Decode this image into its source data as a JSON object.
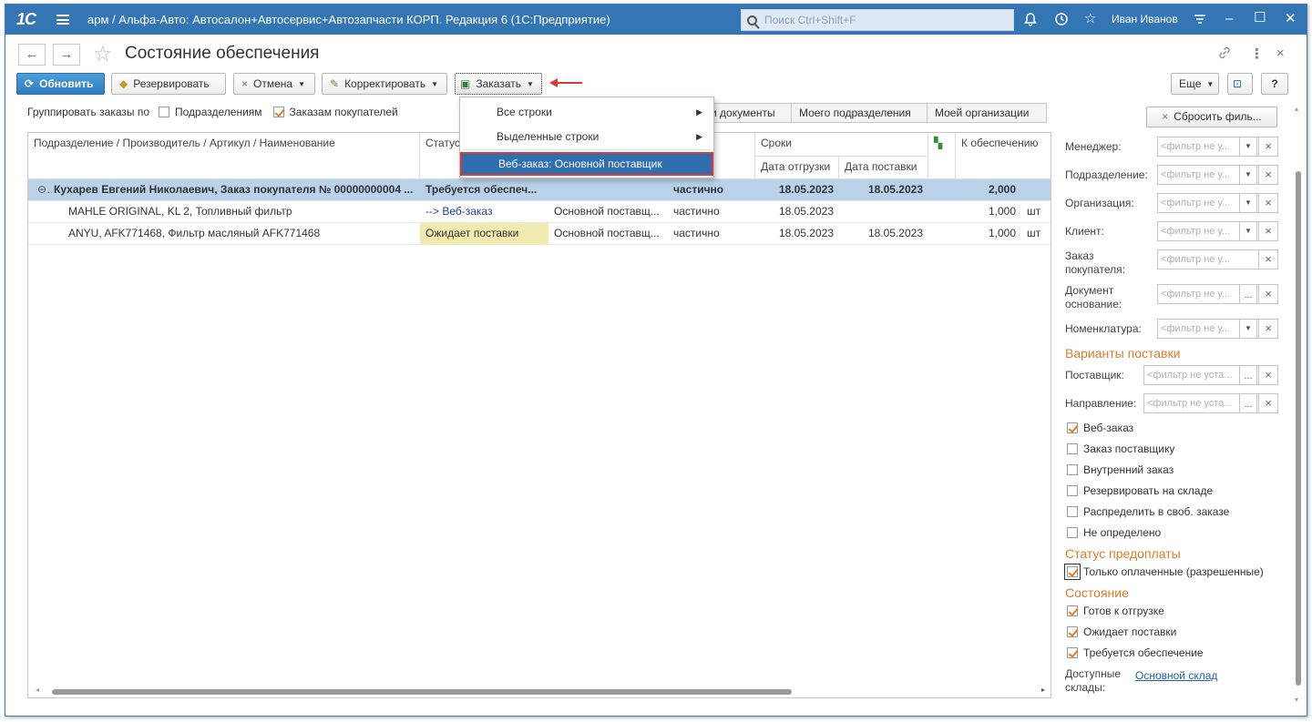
{
  "app": {
    "logo": "1С",
    "title": "арм / Альфа-Авто: Автосалон+Автосервис+Автозапчасти КОРП. Редакция 6  (1С:Предприятие)",
    "search_placeholder": "Поиск Ctrl+Shift+F",
    "user": "Иван Иванов"
  },
  "form": {
    "title": "Состояние обеспечения"
  },
  "toolbar": {
    "refresh": "Обновить",
    "reserve": "Резервировать",
    "cancel": "Отмена",
    "correct": "Корректировать",
    "order": "Заказать",
    "more": "Еще",
    "help": "?"
  },
  "grouping": {
    "label": "Группировать заказы по",
    "by_division": "Подразделениям",
    "by_customer_orders": "Заказам покупателей",
    "by_division_checked": false,
    "by_customer_orders_checked": true
  },
  "segments": [
    "...и документы",
    "Моего подразделения",
    "Моей организации"
  ],
  "order_menu": {
    "items": [
      "Все строки",
      "Выделенные строки",
      "Веб-заказ: Основной поставщик"
    ]
  },
  "table": {
    "headers": {
      "name": "Подразделение / Производитель / Артикул / Наименование",
      "status": "Статус",
      "terms": "Сроки",
      "ship_date": "Дата отгрузки",
      "delivery_date": "Дата поставки",
      "to_supply": "К обеспечению"
    },
    "rows": [
      {
        "name": "Кухарев Евгений Николаевич, Заказ покупателя № 00000000004 ...",
        "status": "Требуется обеспеч...",
        "supplier": "",
        "partial": "частично",
        "ship": "18.05.2023",
        "delivery": "18.05.2023",
        "qty": "2,000",
        "unit": ""
      },
      {
        "name": "MAHLE ORIGINAL, KL 2, Топливный фильтр",
        "status": "--> Веб-заказ",
        "supplier": "Основной поставщ...",
        "partial": "частично",
        "ship": "18.05.2023",
        "delivery": "",
        "qty": "1,000",
        "unit": "шт"
      },
      {
        "name": "ANYU, AFK771468, Фильтр масляный AFK771468",
        "status": "Ожидает поставки",
        "supplier": "Основной поставщ...",
        "partial": "частично",
        "ship": "18.05.2023",
        "delivery": "18.05.2023",
        "qty": "1,000",
        "unit": "шт"
      }
    ]
  },
  "filters": {
    "reset": "Сбросить филь...",
    "fields": [
      {
        "label": "Менеджер:",
        "placeholder": "<фильтр не у..."
      },
      {
        "label": "Подразделение:",
        "placeholder": "<фильтр не у..."
      },
      {
        "label": "Организация:",
        "placeholder": "<фильтр не у..."
      },
      {
        "label": "Клиент:",
        "placeholder": "<фильтр не у..."
      },
      {
        "label": "Заказ покупателя:",
        "placeholder": "<фильтр не у..."
      },
      {
        "label": "Документ основание:",
        "placeholder": "<фильтр не у..."
      },
      {
        "label": "Номенклатура:",
        "placeholder": "<фильтр не у..."
      }
    ],
    "delivery_section": "Варианты поставки",
    "supplier_label": "Поставщик:",
    "supplier_placeholder": "<фильтр не уста...",
    "direction_label": "Направление:",
    "direction_placeholder": "<фильтр не уста...",
    "delivery_options": [
      {
        "label": "Веб-заказ",
        "checked": true
      },
      {
        "label": "Заказ поставщику",
        "checked": false
      },
      {
        "label": "Внутренний заказ",
        "checked": false
      },
      {
        "label": "Резервировать на складе",
        "checked": false
      },
      {
        "label": "Распределить в своб. заказе",
        "checked": false
      },
      {
        "label": "Не определено",
        "checked": false
      }
    ],
    "prepay_section": "Статус предоплаты",
    "prepay_option": {
      "label": "Только оплаченные (разрешенные)",
      "checked": true
    },
    "state_section": "Состояние",
    "state_options": [
      {
        "label": "Готов к отгрузке",
        "checked": true
      },
      {
        "label": "Ожидает поставки",
        "checked": true
      },
      {
        "label": "Требуется обеспечение",
        "checked": true
      }
    ],
    "warehouses_label": "Доступные склады:",
    "warehouses_value": "Основной склад"
  },
  "colors": {
    "titlebar": "#3476b4",
    "accent_orange": "#e07b2a",
    "group_row": "#b9d2ea",
    "status_highlight": "#f2ebb0",
    "menu_selected": "#2f6fad",
    "annotation_red": "#d63a3a"
  }
}
